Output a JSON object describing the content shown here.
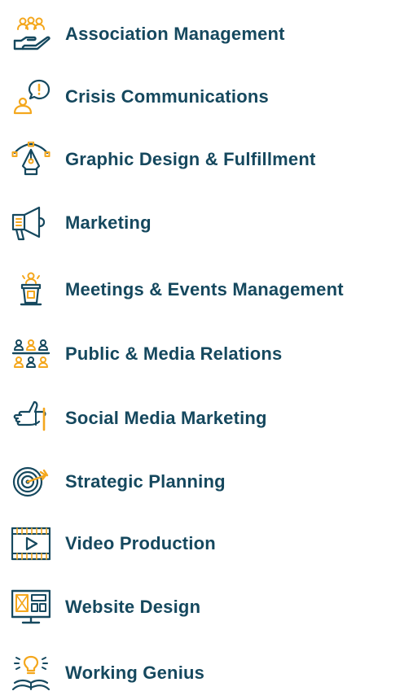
{
  "colors": {
    "text": "#15485e",
    "icon_dark": "#15485e",
    "icon_accent": "#f4a71d"
  },
  "services": [
    {
      "label": "Association Management",
      "icon": "people-hand-icon"
    },
    {
      "label": "Crisis Communications",
      "icon": "alert-person-icon"
    },
    {
      "label": "Graphic Design & Fulfillment",
      "icon": "pen-tool-icon"
    },
    {
      "label": "Marketing",
      "icon": "megaphone-icon"
    },
    {
      "label": "Meetings & Events Management",
      "icon": "speaker-podium-icon"
    },
    {
      "label": "Public & Media Relations",
      "icon": "audience-icon"
    },
    {
      "label": "Social Media Marketing",
      "icon": "thumbs-up-icon"
    },
    {
      "label": "Strategic Planning",
      "icon": "target-icon"
    },
    {
      "label": "Video Production",
      "icon": "video-player-icon"
    },
    {
      "label": "Website Design",
      "icon": "website-monitor-icon"
    },
    {
      "label": "Working Genius",
      "icon": "lightbulb-book-icon"
    }
  ]
}
